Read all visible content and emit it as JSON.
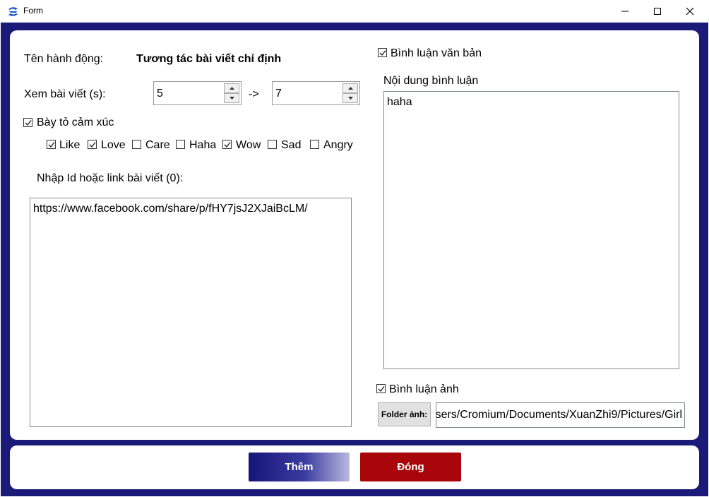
{
  "window": {
    "title": "Form",
    "app_icon": "app-logo-icon",
    "controls": [
      "minimize-icon",
      "maximize-icon",
      "close-icon"
    ]
  },
  "action": {
    "label": "Tên hành động:",
    "value": "Tương tác bài viết chỉ định"
  },
  "view_time": {
    "label": "Xem bài viết (s):",
    "from": "5",
    "separator": "->",
    "to": "7"
  },
  "reactions": {
    "label": "Bày tỏ cảm xúc",
    "enabled": true,
    "items": [
      {
        "label": "Like",
        "checked": true
      },
      {
        "label": "Love",
        "checked": true
      },
      {
        "label": "Care",
        "checked": false
      },
      {
        "label": "Haha",
        "checked": false
      },
      {
        "label": "Wow",
        "checked": true
      },
      {
        "label": "Sad",
        "checked": false
      },
      {
        "label": "Angry",
        "checked": false
      }
    ]
  },
  "post_input": {
    "label": "Nhập Id hoặc link bài viết (0):",
    "value": "https://www.facebook.com/share/p/fHY7jsJ2XJaiBcLM/"
  },
  "comment_text": {
    "label": "Bình luận văn bản",
    "enabled": true,
    "content_label": "Nội dung bình luận",
    "content": "haha"
  },
  "comment_image": {
    "label": "Bình luận ảnh",
    "enabled": true,
    "folder_button": "Folder ảnh:",
    "folder_path_visible": "sers/Cromium/Documents/XuanZhi9/Pictures/Girl"
  },
  "buttons": {
    "add": "Thêm",
    "close": "Đóng"
  },
  "colors": {
    "frame": "#1c1a78",
    "add_button": "#1f1f85",
    "close_button": "#a8060b"
  }
}
